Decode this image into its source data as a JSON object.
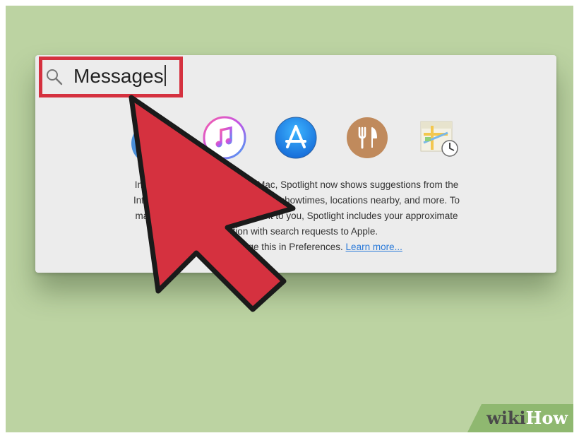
{
  "spotlight": {
    "search": {
      "query": "Messages"
    },
    "suggestion_icons": [
      {
        "name": "itunes-icon"
      },
      {
        "name": "app-store-icon"
      },
      {
        "name": "restaurant-icon"
      },
      {
        "name": "maps-icon"
      }
    ],
    "info": {
      "line1": "In addition to searching your Mac, Spotlight now shows suggestions from the",
      "line2": "Internet, iTunes, App Store, movie showtimes, locations nearby, and more. To",
      "line3": "make suggestions more relevant to you, Spotlight includes your approximate",
      "line4": "location with search requests to Apple.",
      "line5_prefix": "You can change this in Preferences. ",
      "learn_more": "Learn more..."
    }
  },
  "watermark": {
    "wiki": "wiki",
    "how": "How"
  },
  "colors": {
    "background": "#bcd3a2",
    "panel": "#ececec",
    "highlight": "#d5313f",
    "arrow": "#d5313f",
    "link": "#2b7ad9"
  }
}
